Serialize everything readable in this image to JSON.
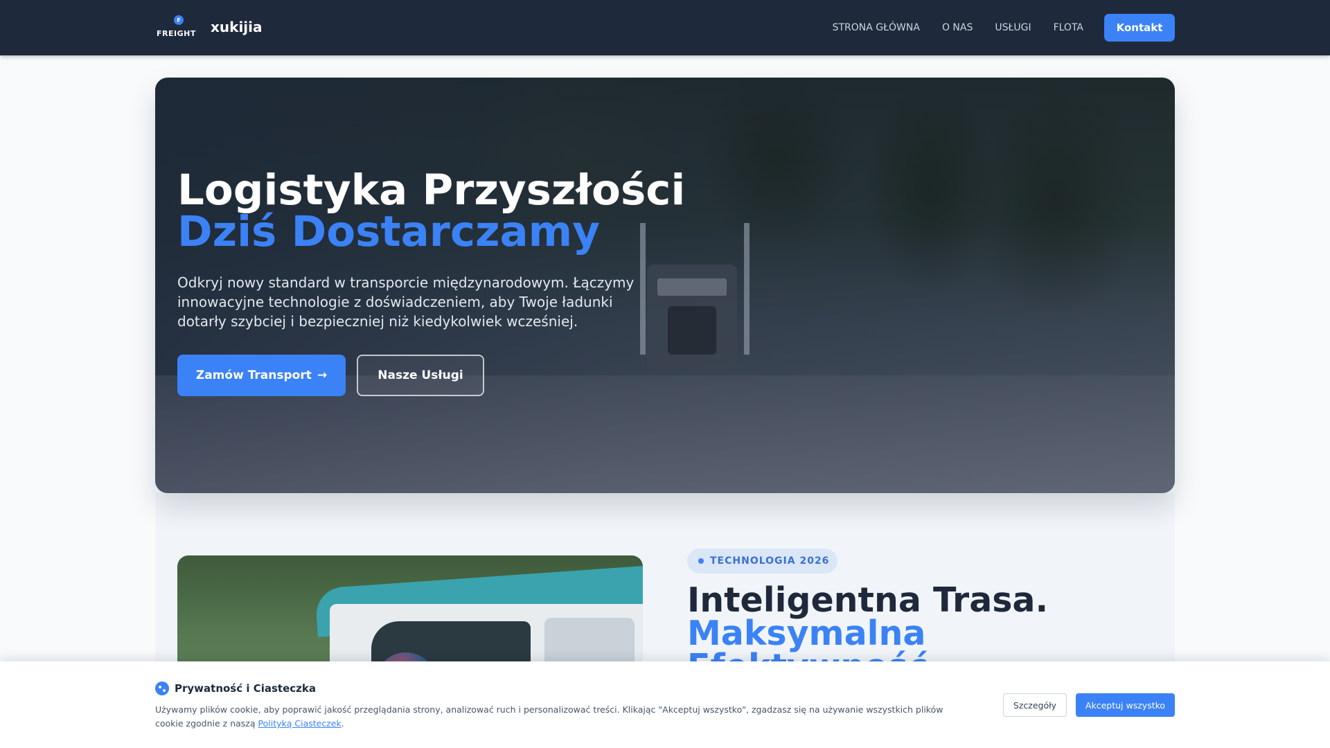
{
  "brand": {
    "logo_letter": "F",
    "logo_text": "FREIGHT",
    "name": "xukijia"
  },
  "nav": {
    "links": [
      "STRONA GŁÓWNA",
      "O NAS",
      "USŁUGI",
      "FLOTA"
    ],
    "cta": "Kontakt"
  },
  "hero": {
    "title_line1": "Logistyka Przyszłości",
    "title_line2": "Dziś Dostarczamy",
    "description": "Odkryj nowy standard w transporcie międzynarodowym. Łączymy innowacyjne technologie z doświadczeniem, aby Twoje ładunki dotarły szybciej i bezpieczniej niż kiedykolwiek wcześniej.",
    "primary_button": "Zamów Transport",
    "primary_button_arrow": "→",
    "secondary_button": "Nasze Usługi"
  },
  "section": {
    "tag": "TECHNOLOGIA 2026",
    "title_line1": "Inteligentna Trasa.",
    "title_line2": "Maksymalna",
    "title_line3": "Efektywność."
  },
  "cookie": {
    "title": "Prywatność i Ciasteczka",
    "text_before_link": "Używamy plików cookie, aby poprawić jakość przeglądania strony, analizować ruch i personalizować treści. Klikając \"Akceptuj wszystko\", zgadzasz się na używanie wszystkich plików cookie zgodnie z naszą ",
    "link_text": "Polityką Ciasteczek",
    "text_after_link": ".",
    "details_button": "Szczegóły",
    "accept_button": "Akceptuj wszystko"
  },
  "colors": {
    "accent": "#3b82f6",
    "nav_bg": "#1e293b",
    "tag_bg": "#dbe7f7"
  }
}
